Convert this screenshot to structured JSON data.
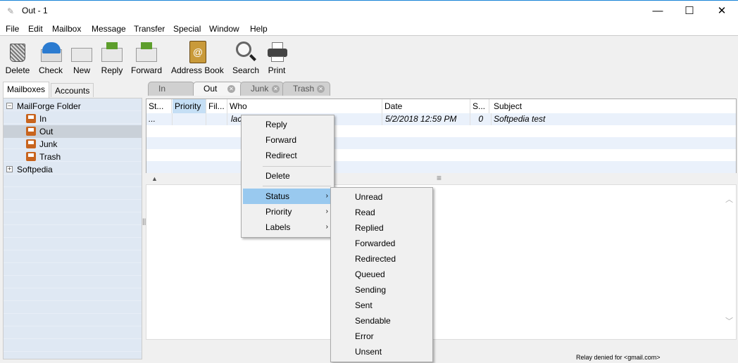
{
  "window": {
    "title": "Out - 1",
    "icon": "app-icon",
    "minimize": "—",
    "maximize": "☐",
    "close": "✕"
  },
  "menubar": [
    "File",
    "Edit",
    "Mailbox",
    "Message",
    "Transfer",
    "Special",
    "Window",
    "Help"
  ],
  "toolbar": [
    {
      "label": "Delete",
      "icon": "trash-icon"
    },
    {
      "label": "Check",
      "icon": "check-mail-icon"
    },
    {
      "label": "New",
      "icon": "new-mail-icon"
    },
    {
      "label": "Reply",
      "icon": "reply-icon"
    },
    {
      "label": "Forward",
      "icon": "forward-icon"
    },
    {
      "label": "Address Book",
      "icon": "address-book-icon"
    },
    {
      "label": "Search",
      "icon": "search-icon"
    },
    {
      "label": "Print",
      "icon": "printer-icon"
    }
  ],
  "sidebar": {
    "tabs": [
      "Mailboxes",
      "Accounts"
    ],
    "tree": [
      {
        "label": "MailForge Folder",
        "expander": "−"
      },
      {
        "label": "In"
      },
      {
        "label": "Out",
        "selected": true
      },
      {
        "label": "Junk"
      },
      {
        "label": "Trash"
      },
      {
        "label": "Softpedia",
        "expander": "+"
      }
    ]
  },
  "mailbox_tabs": [
    {
      "label": "In"
    },
    {
      "label": "Out",
      "active": true
    },
    {
      "label": "Junk"
    },
    {
      "label": "Trash"
    }
  ],
  "table": {
    "columns": [
      "St...",
      "Priority",
      "Fil...",
      "Who",
      "Date",
      "S...",
      "Subject"
    ],
    "rows": [
      {
        "status": "...",
        "priority": "",
        "filter": "",
        "who": "lac",
        "date": "5/2/2018 12:59 PM",
        "size": "0",
        "subject": "Softpedia test"
      }
    ]
  },
  "status_bar": "Relay denied for <gmail.com>",
  "context_menu": {
    "items": [
      "Reply",
      "Forward",
      "Redirect",
      "Delete",
      "Status",
      "Priority",
      "Labels"
    ],
    "submenu_arrow": "›"
  },
  "status_submenu": [
    "Unread",
    "Read",
    "Replied",
    "Forwarded",
    "Redirected",
    "Queued",
    "Sending",
    "Sent",
    "Sendable",
    "Error",
    "Unsent"
  ],
  "colors": {
    "highlight": "#99c9ef",
    "selected_folder": "#c9d0d8",
    "priority_header": "#c5dff5"
  }
}
